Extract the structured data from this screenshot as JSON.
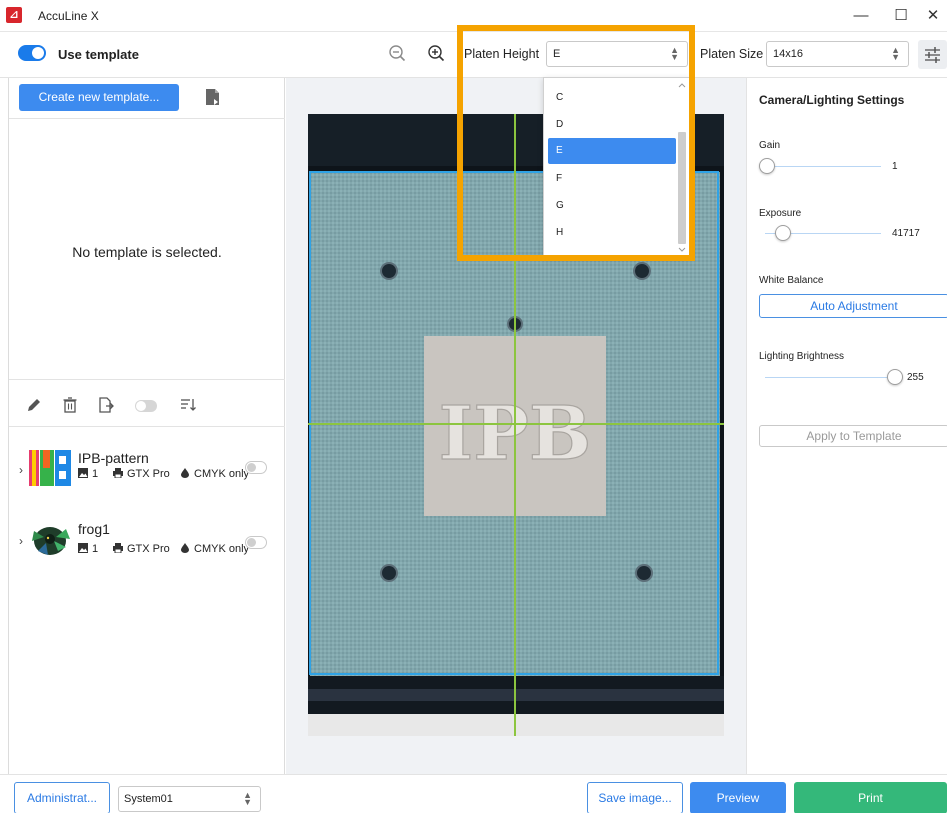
{
  "window": {
    "title": "AccuLine X",
    "controls": [
      "—",
      "☐",
      "✕"
    ]
  },
  "toolbar": {
    "use_template_label": "Use template",
    "use_template_on": true,
    "platen_height_label": "Platen Height",
    "platen_height_value": "E",
    "platen_size_label": "Platen Size",
    "platen_size_value": "14x16"
  },
  "platen_height_dropdown": {
    "options": [
      "C",
      "D",
      "E",
      "F",
      "G",
      "H"
    ],
    "selected": "E"
  },
  "left_panel": {
    "create_button": "Create new template...",
    "empty_message": "No template is selected.",
    "templates": [
      {
        "name": "IPB-pattern",
        "count": "1",
        "printer": "GTX Pro",
        "ink": "CMYK only"
      },
      {
        "name": "frog1",
        "count": "1",
        "printer": "GTX Pro",
        "ink": "CMYK only"
      }
    ]
  },
  "preview": {
    "logo_text": "IPB"
  },
  "right_panel": {
    "title": "Camera/Lighting Settings",
    "gain_label": "Gain",
    "gain_value": "1",
    "exposure_label": "Exposure",
    "exposure_value": "41717",
    "white_balance_label": "White Balance",
    "auto_adjust_button": "Auto Adjustment",
    "lighting_brightness_label": "Lighting Brightness",
    "lighting_brightness_value": "255",
    "apply_button": "Apply to Template"
  },
  "bottom_bar": {
    "admin_button": "Administrat...",
    "system_value": "System01",
    "save_image_button": "Save image...",
    "preview_button": "Preview",
    "print_button": "Print"
  },
  "colors": {
    "accent": "#3d8bef",
    "print_green": "#34b87a",
    "highlight": "#f5a300",
    "app_red": "#d8262c"
  }
}
